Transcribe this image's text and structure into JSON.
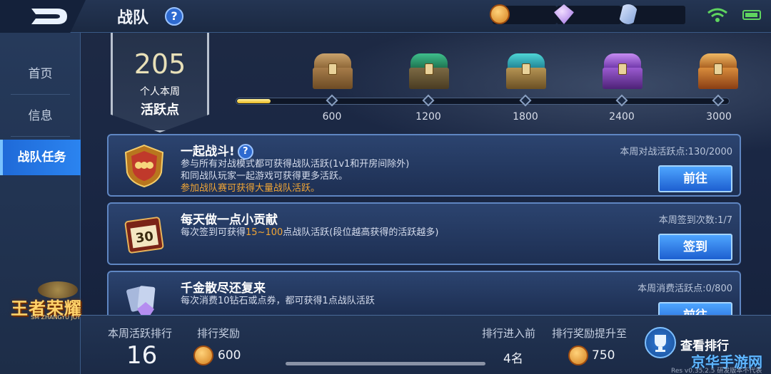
{
  "header": {
    "title": "战队",
    "help_icon": "?"
  },
  "resources": [
    "gold-coin-icon",
    "diamond-icon",
    "voucher-icon"
  ],
  "sidebar": {
    "items": [
      {
        "label": "首页"
      },
      {
        "label": "信息"
      },
      {
        "label": "战队任务",
        "active": true
      }
    ]
  },
  "game_logo": {
    "text": "王者荣耀",
    "sub": "SM ZHANGYU JOY"
  },
  "activity": {
    "points": "205",
    "label_line1": "个人本周",
    "label_line2": "活跃点",
    "progress_fraction": 0.068
  },
  "milestones": [
    {
      "value": "600",
      "chest": "bronze-chest-icon"
    },
    {
      "value": "1200",
      "chest": "green-chest-icon"
    },
    {
      "value": "1800",
      "chest": "teal-chest-icon"
    },
    {
      "value": "2400",
      "chest": "purple-chest-icon"
    },
    {
      "value": "3000",
      "chest": "gold-chest-icon"
    }
  ],
  "tasks": [
    {
      "title": "一起战斗!",
      "has_help": true,
      "line1": "参与所有对战模式都可获得战队活跃(1v1和开房间除外)",
      "line2": "和同战队玩家一起游戏可获得更多活跃。",
      "line3": "参加战队赛可获得大量战队活跃。",
      "stat": "本周对战活跃点:130/2000",
      "button": "前往"
    },
    {
      "title": "每天做一点小贡献",
      "line1_pre": "每次签到可获得",
      "line1_hl": "15~100",
      "line1_post": "点战队活跃(段位越高获得的活跃越多)",
      "stat": "本周签到次数:1/7",
      "button": "签到",
      "icon_text": "30"
    },
    {
      "title": "千金散尽还复来",
      "line1": "每次消费10钻石或点券，都可获得1点战队活跃",
      "stat": "本周消费活跃点:0/800",
      "button": "前往"
    }
  ],
  "bottom": {
    "rank_label": "本周活跃排行",
    "rank_value": "16",
    "reward_label": "排行奖励",
    "reward_value": "600",
    "prev_label": "排行进入前",
    "prev_value": "4名",
    "boost_label": "排行奖励提升至",
    "boost_value": "750",
    "view_button": "查看排行"
  },
  "watermark": "京华手游网",
  "version": "Res v0.35.2.5 研发版本不代表"
}
